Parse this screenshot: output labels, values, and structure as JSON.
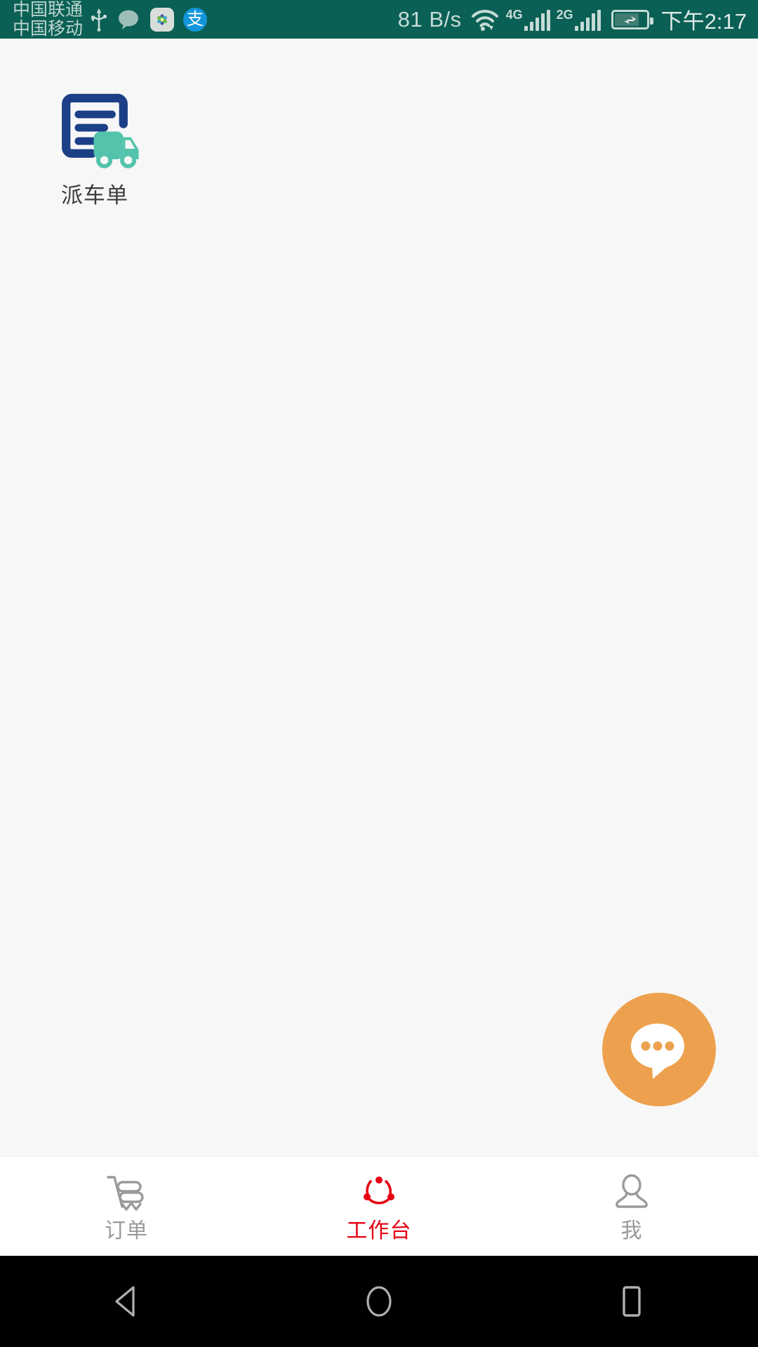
{
  "status_bar": {
    "carriers": [
      "中国联通",
      "中国移动"
    ],
    "icons": [
      "usb-icon",
      "message-bubble-icon",
      "photos-icon",
      "alipay-icon"
    ],
    "alipay_glyph": "支",
    "network_speed": "81 B/s",
    "wifi": "wifi-icon",
    "sim1_network": "4G",
    "sim2_network": "2G",
    "battery": "charging-battery-icon",
    "time": "下午2:17",
    "background_color": "#0a6054",
    "text_color": "#c6dbd6"
  },
  "content": {
    "background_color": "#f7f7f7",
    "apps": [
      {
        "label": "派车单",
        "icon": "dispatch-order-truck-icon",
        "doc_color": "#1c3f87",
        "truck_color": "#54c3ac"
      }
    ]
  },
  "fab": {
    "name": "chat-fab",
    "icon": "chat-bubble-dots-icon",
    "background_color": "#eda14e",
    "icon_color": "#ffffff"
  },
  "tab_bar": {
    "background_color": "#ffffff",
    "active_color": "#e60012",
    "inactive_color": "#9a9a9a",
    "tabs": [
      {
        "label": "订单",
        "icon": "shopping-cart-icon",
        "active": false
      },
      {
        "label": "工作台",
        "icon": "workbench-circle-icon",
        "active": true
      },
      {
        "label": "我",
        "icon": "person-icon",
        "active": false
      }
    ]
  },
  "android_nav": {
    "background_color": "#000000",
    "buttons": [
      {
        "name": "back-button",
        "icon": "back-triangle-icon"
      },
      {
        "name": "home-button",
        "icon": "home-circle-icon"
      },
      {
        "name": "recents-button",
        "icon": "recents-square-icon"
      }
    ]
  }
}
